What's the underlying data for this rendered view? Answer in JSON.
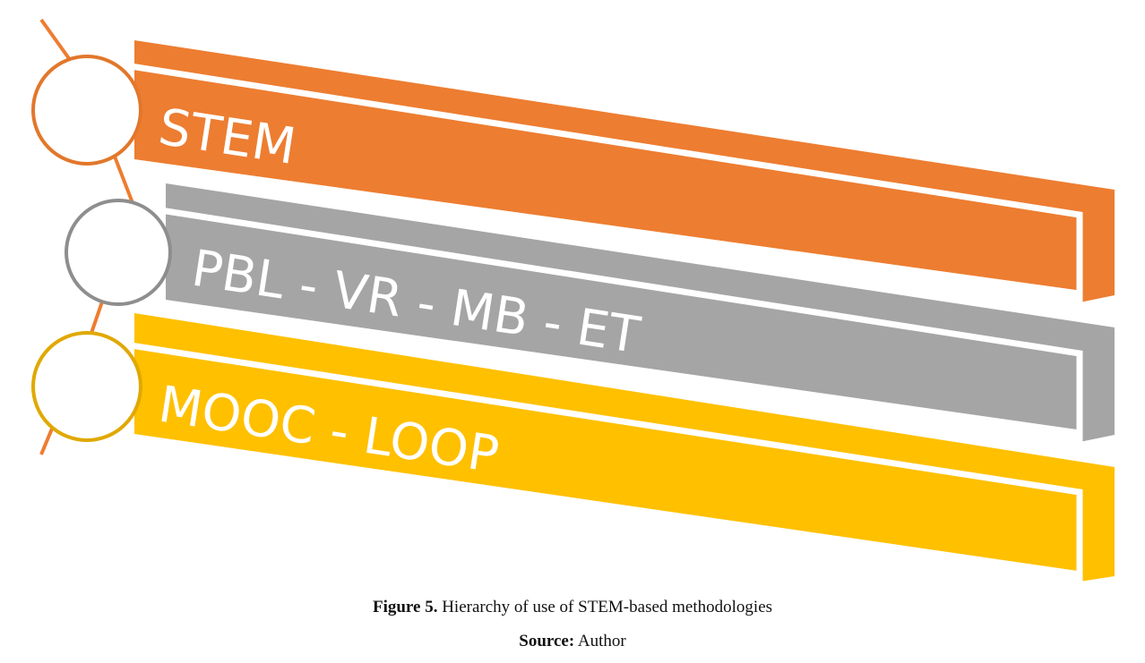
{
  "diagram": {
    "levels": [
      {
        "label": "STEM",
        "color": "#ED7D31",
        "border": "#E2772B"
      },
      {
        "label": "PBL - VR - MB - ET",
        "color": "#A5A5A5",
        "border": "#8E8E8E"
      },
      {
        "label": "MOOC - LOOP",
        "color": "#FFC000",
        "border": "#E0A800"
      }
    ],
    "connector_color": "#ED7D31"
  },
  "caption": {
    "figure_prefix": "Figure 5.",
    "figure_text": " Hierarchy of use of STEM-based methodologies",
    "source_prefix": "Source:",
    "source_text": " Author"
  }
}
